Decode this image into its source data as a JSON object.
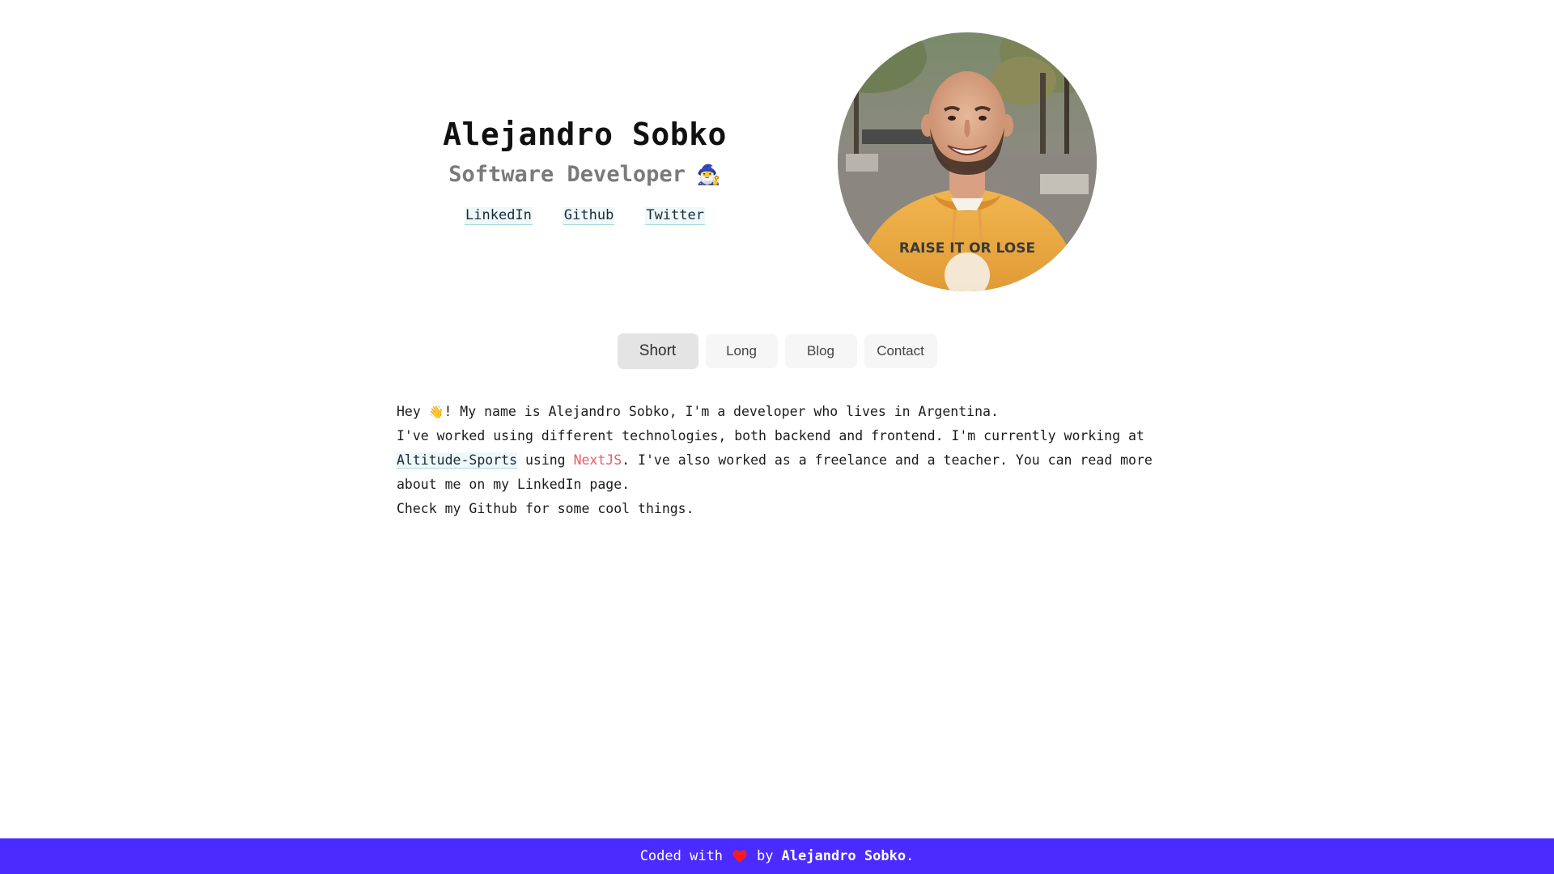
{
  "header": {
    "name": "Alejandro Sobko",
    "role": "Software Developer",
    "role_emoji": "🧙‍♂️",
    "links": [
      {
        "label": "LinkedIn"
      },
      {
        "label": "Github"
      },
      {
        "label": "Twitter"
      }
    ]
  },
  "avatar": {
    "alt": "Alejandro Sobko",
    "shirt_text": "RAISE IT OR LOSE"
  },
  "tabs": [
    {
      "label": "Short",
      "active": true
    },
    {
      "label": "Long",
      "active": false
    },
    {
      "label": "Blog",
      "active": false
    },
    {
      "label": "Contact",
      "active": false
    }
  ],
  "content": {
    "line1_a": "Hey ",
    "wave": "👋",
    "line1_b": "! My name is Alejandro Sobko, I'm a developer who lives in Argentina.",
    "line2": "I've worked using different technologies, both backend and frontend. I'm currently working at",
    "company_link": "Altitude-Sports",
    "using": " using ",
    "tech": "NextJS",
    "line3_rest": ". I've also worked as a freelance and a teacher. You can read more",
    "line4": "about me on my LinkedIn page.",
    "line5": "Check my Github for some cool things."
  },
  "footer": {
    "prefix": "Coded with",
    "heart_icon": "heart-icon",
    "by": "by",
    "author": "Alejandro Sobko",
    "suffix": "."
  },
  "colors": {
    "footer_bg": "#4b2bff",
    "tech_red": "#ea5b6a",
    "link_bg": "#eef8f8",
    "heart": "#ff1a1a"
  }
}
